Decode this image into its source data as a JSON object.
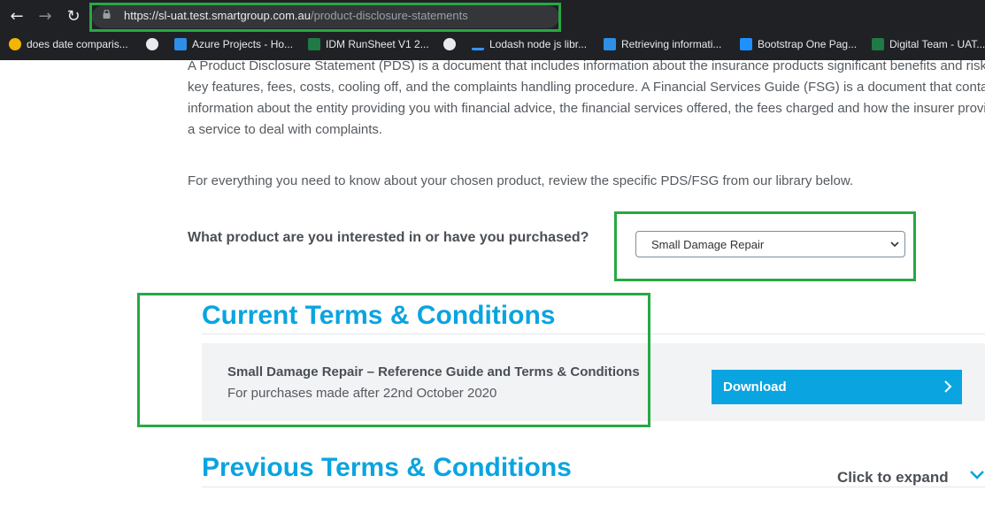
{
  "browser": {
    "url_host": "https://sl-uat.test.smartgroup.com.au",
    "url_path": "/product-disclosure-statements",
    "bookmarks": [
      {
        "label": "does date comparis...",
        "icon": "sparkle-icon",
        "color": "#f2b600"
      },
      {
        "label": "",
        "icon": "globe-icon",
        "color": "#e8eaed"
      },
      {
        "label": "Azure Projects - Ho...",
        "icon": "azure-devops-icon",
        "color": "#2d8fe6"
      },
      {
        "label": "IDM RunSheet V1 2...",
        "icon": "excel-icon",
        "color": "#1e7b45"
      },
      {
        "label": "",
        "icon": "globe-icon",
        "color": "#e8eaed"
      },
      {
        "label": "Lodash node js libr...",
        "icon": "lodash-icon",
        "color": "#3492ff"
      },
      {
        "label": "Retrieving informati...",
        "icon": "retrieve-icon",
        "color": "#2d8fe6"
      },
      {
        "label": "Bootstrap One Pag...",
        "icon": "bootstrap-icon",
        "color": "#1e90ff"
      },
      {
        "label": "Digital Team - UAT...",
        "icon": "excel-icon",
        "color": "#1e7b45"
      }
    ]
  },
  "page": {
    "intro_paragraph": "A Product Disclosure Statement (PDS) is a document that includes information about the insurance products significant benefits and risks, key features, fees, costs, cooling off, and the complaints handling procedure. A Financial Services Guide (FSG) is a document that contains information about the entity providing you with financial advice, the financial services offered, the fees charged and how the insurer provides a service to deal with complaints.",
    "library_paragraph": "For everything you need to know about your chosen product, review the specific PDS/FSG from our library below.",
    "product_question": "What product are you interested in or have you purchased?",
    "product_select_value": "Small Damage Repair",
    "current_heading": "Current Terms & Conditions",
    "current_doc": {
      "title": "Small Damage Repair – Reference Guide and Terms & Conditions",
      "subtitle": "For purchases made after 22nd October 2020",
      "download_label": "Download"
    },
    "previous_heading": "Previous Terms & Conditions",
    "expand_label": "Click to expand"
  },
  "colors": {
    "accent": "#0aa4e0",
    "highlight_box": "#27a844",
    "card_bg": "#f1f3f5"
  }
}
